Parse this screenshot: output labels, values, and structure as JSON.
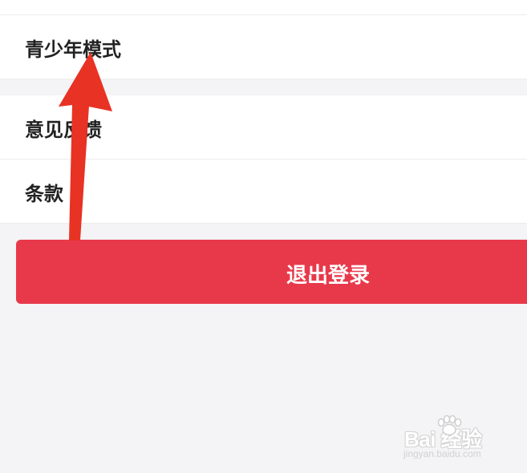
{
  "settings": {
    "group_1": {
      "items": [
        {
          "label": "青少年模式"
        }
      ]
    },
    "group_2": {
      "items": [
        {
          "label": "意见反馈"
        },
        {
          "label": "条款"
        }
      ]
    }
  },
  "logout": {
    "label": "退出登录"
  },
  "annotation": {
    "icon": "red-arrow-icon",
    "color": "#e83224",
    "points_to": "青少年模式"
  },
  "watermark": {
    "brand": "Bai 经验",
    "url": "jingyan.baidu.com"
  },
  "colors": {
    "background": "#f4f3f5",
    "card": "#ffffff",
    "logout_button": "#e8394b",
    "text": "#222222"
  }
}
